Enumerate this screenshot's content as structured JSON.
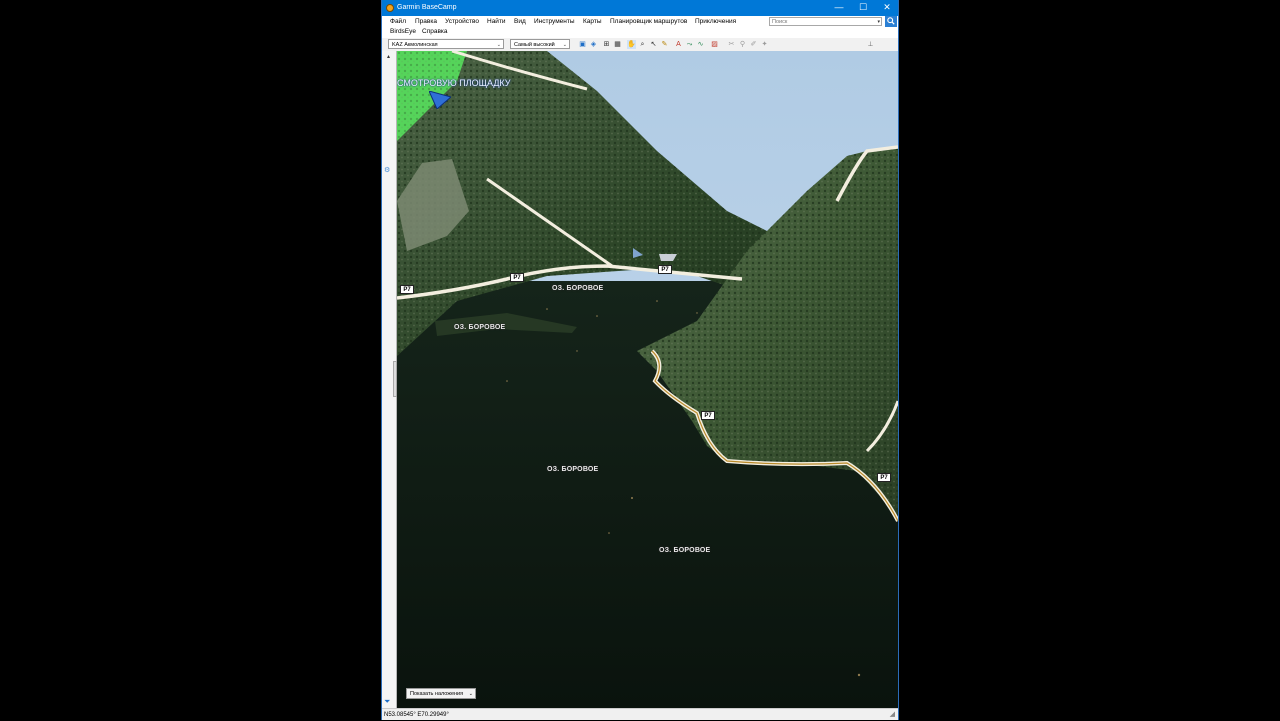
{
  "window": {
    "title": "Garmin BaseCamp",
    "minimize": "—",
    "maximize": "☐",
    "close": "✕"
  },
  "menu": {
    "items": [
      "Файл",
      "Правка",
      "Устройство",
      "Найти",
      "Вид",
      "Инструменты",
      "Карты",
      "Планировщик маршрутов",
      "Приключения",
      "BirdsEye",
      "Справка"
    ]
  },
  "search": {
    "placeholder": "Поиск"
  },
  "toolbar": {
    "map_product": "KAZ Акмолинская",
    "detail_level": "Самый высокий"
  },
  "map": {
    "poi_label": "СМОТРОВУЮ ПЛОЩАДКУ",
    "lake_labels": [
      "ОЗ. БОРОВОЕ",
      "ОЗ. БОРОВОЕ",
      "ОЗ. БОРОВОЕ",
      "ОЗ. БОРОВОЕ"
    ],
    "route_badges": [
      "Р7",
      "Р7",
      "Р7",
      "Р7",
      "Р7"
    ],
    "overlay_button": "Показать наложения"
  },
  "status": {
    "coordinates": "N53.08545° E70.29949°"
  },
  "colors": {
    "titlebar": "#0078d7",
    "water": "#0d1a12",
    "forest": "#2f4a2a",
    "sky": "#b7cfe6",
    "road": "#f4efe2"
  }
}
